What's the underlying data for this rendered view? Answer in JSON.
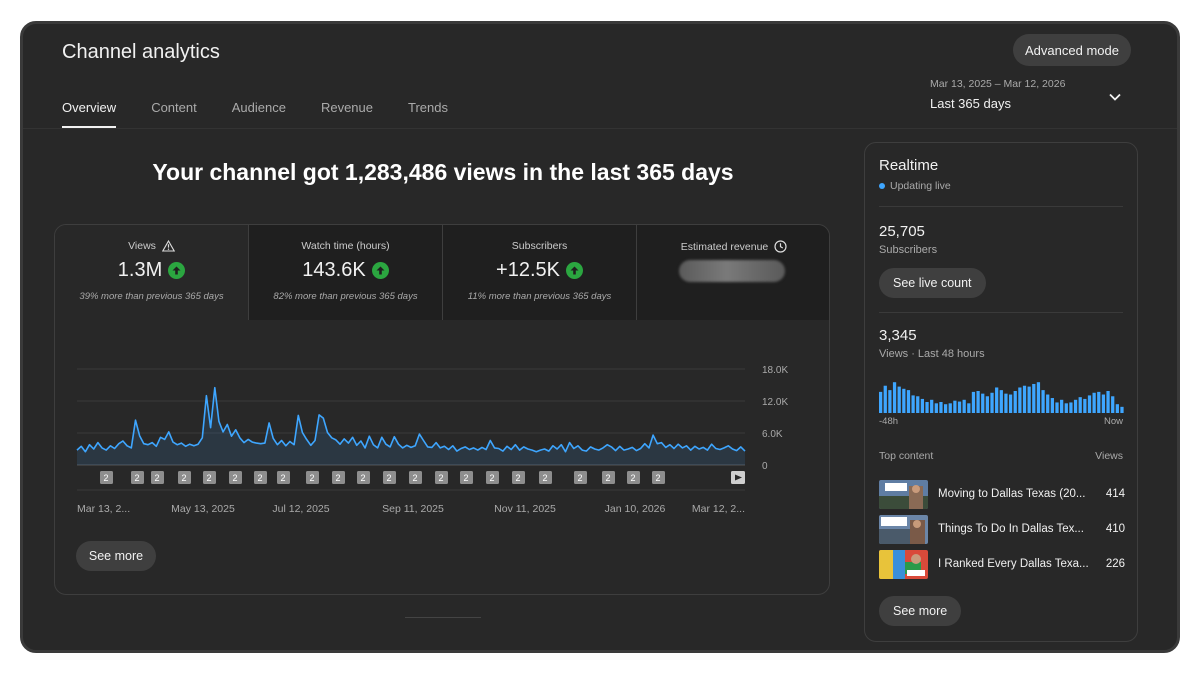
{
  "header": {
    "title": "Channel analytics",
    "advanced_mode_label": "Advanced mode",
    "date_range": "Mar 13, 2025 – Mar 12, 2026",
    "date_label": "Last 365 days"
  },
  "tabs": [
    {
      "label": "Overview",
      "active": true
    },
    {
      "label": "Content"
    },
    {
      "label": "Audience"
    },
    {
      "label": "Revenue"
    },
    {
      "label": "Trends"
    }
  ],
  "headline": "Your channel got 1,283,486 views in the last 365 days",
  "metrics": [
    {
      "label": "Views",
      "value": "1.3M",
      "note": "39% more than previous 365 days",
      "icon": "warning-icon"
    },
    {
      "label": "Watch time (hours)",
      "value": "143.6K",
      "note": "82% more than previous 365 days"
    },
    {
      "label": "Subscribers",
      "value": "+12.5K",
      "note": "11% more than previous 365 days"
    },
    {
      "label": "Estimated revenue",
      "icon": "clock-icon"
    }
  ],
  "colors": {
    "line": "#3ea6ff",
    "up_arrow": "#2ba640",
    "live_dot": "#3ea6ff",
    "bars": "#3ea6ff"
  },
  "chart_data": {
    "type": "line",
    "y_ticks": [
      "18.0K",
      "12.0K",
      "6.0K",
      "0"
    ],
    "ylim": [
      0,
      18000
    ],
    "x_tick_labels": [
      "Mar 13, 2...",
      "May 13, 2025",
      "Jul 12, 2025",
      "Sep 11, 2025",
      "Nov 11, 2025",
      "Jan 10, 2026",
      "Mar 12, 2..."
    ],
    "x_range": [
      "2025-03-13",
      "2026-03-12"
    ],
    "series": [
      {
        "values": [
          2800,
          3500,
          2500,
          3800,
          3000,
          4200,
          3200,
          2800,
          3600,
          3100,
          4000,
          4500,
          3600,
          3200,
          8400,
          5500,
          4000,
          3800,
          4200,
          3500,
          5200,
          4800,
          6200,
          4300,
          3800,
          4100,
          3500,
          3900,
          3600,
          3900,
          5100,
          13000,
          7000,
          14500,
          8200,
          6200,
          7600,
          5400,
          6600,
          5100,
          4200,
          4800,
          4300,
          4100,
          4000,
          4100,
          7900,
          5000,
          3800,
          4600,
          3600,
          4400,
          3800,
          9300,
          6100,
          4800,
          3700,
          4600,
          9400,
          8800,
          6100,
          5100,
          4700,
          3900,
          4900,
          4100,
          5200,
          3700,
          4500,
          3200,
          5400,
          3800,
          3200,
          5200,
          3900,
          3400,
          5300,
          3900,
          3200,
          3700,
          3300,
          3600,
          5800,
          4600,
          3400,
          3300,
          4200,
          3200,
          3500,
          2900,
          3600,
          2600,
          3100,
          3400,
          2900,
          3200,
          2800,
          3300,
          2900,
          4600,
          3200,
          3100,
          2600,
          3500,
          2900,
          3800,
          2800,
          3400,
          3000,
          2800,
          2500,
          2800,
          3000,
          2600,
          3600,
          3000,
          3800,
          2500,
          4200,
          3100,
          3600,
          2800,
          2600,
          3400,
          3000,
          2800,
          3200,
          3800,
          3400,
          2700,
          3500,
          2800,
          3000,
          3300,
          2700,
          3100,
          4000,
          3200,
          5600,
          4000,
          4200,
          3300,
          3800,
          3100,
          3900,
          3200,
          3600,
          2800,
          3500,
          3000,
          3300,
          2800,
          3900,
          3100,
          2900,
          3200,
          3600,
          3000,
          2700,
          3400,
          2600
        ]
      }
    ],
    "annotation_markers": [
      {
        "label": "2",
        "count": 22
      },
      {
        "label": "play-icon",
        "count": 1
      }
    ]
  },
  "see_more_label": "See more",
  "realtime": {
    "title": "Realtime",
    "updating": "Updating live",
    "subscribers_count": "25,705",
    "subscribers_label": "Subscribers",
    "see_live_count": "See live count",
    "views_count": "3,345",
    "views_label": "Views · Last 48 hours",
    "axis_start": "-48h",
    "axis_end": "Now",
    "bars": [
      48,
      62,
      52,
      70,
      60,
      55,
      52,
      40,
      38,
      32,
      25,
      30,
      22,
      25,
      20,
      22,
      28,
      26,
      30,
      22,
      48,
      50,
      44,
      38,
      46,
      58,
      52,
      44,
      42,
      50,
      58,
      62,
      60,
      66,
      70,
      52,
      42,
      34,
      24,
      30,
      22,
      24,
      30,
      36,
      32,
      40,
      46,
      48,
      42,
      50,
      38,
      20,
      14
    ],
    "top_content_label": "Top content",
    "views_col_label": "Views",
    "top_content": [
      {
        "title": "Moving to Dallas Texas (20...",
        "views": "414"
      },
      {
        "title": "Things To Do In Dallas Tex...",
        "views": "410"
      },
      {
        "title": "I Ranked Every Dallas Texa...",
        "views": "226"
      }
    ],
    "see_more": "See more"
  }
}
